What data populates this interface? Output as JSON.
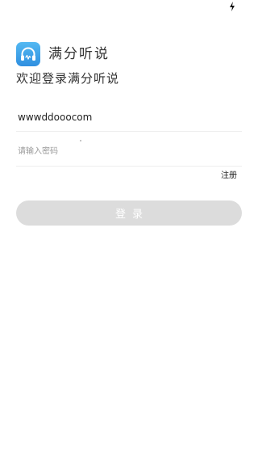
{
  "status_bar": {
    "icon": "charging-bolt-icon"
  },
  "brand": {
    "logo_icon": "headphones-icon",
    "logo_color": "#3a9eea",
    "app_name": "满分听说"
  },
  "welcome_text": "欢迎登录满分听说",
  "username": {
    "value": "wwwddooocom"
  },
  "password": {
    "placeholder": "请输入密码"
  },
  "register_label": "注册",
  "login_label": "登录",
  "colors": {
    "button_disabled": "#dcdcdc",
    "divider": "#eeeeee"
  }
}
